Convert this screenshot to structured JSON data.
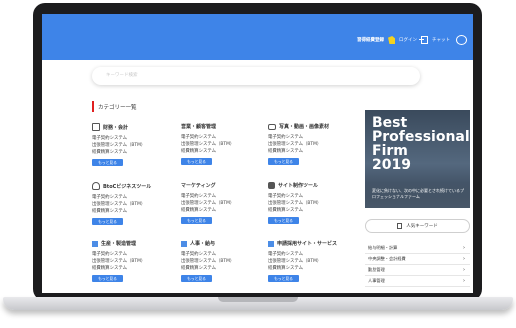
{
  "header": {
    "brand_label": "習得経費登録",
    "login_label": "ログイン",
    "chat_label": "チャット"
  },
  "search": {
    "placeholder": "キーワード検索"
  },
  "category_heading": "カテゴリー一覧",
  "blocks": [
    {
      "icon": "calculator-icon",
      "title": "財務・会計",
      "lines": [
        "電子契約システム",
        "出張管理システム（BTM）",
        "経費精算システム"
      ],
      "more": "もっと見る"
    },
    {
      "icon": "sales-icon",
      "title": "営業・顧客管理",
      "lines": [
        "電子契約システム",
        "出張管理システム（BTM）",
        "経費精算システム"
      ],
      "more": "もっと見る"
    },
    {
      "icon": "camera-icon",
      "title": "写真・動画・画像素材",
      "lines": [
        "電子契約システム",
        "出張管理システム（BTM）",
        "経費精算システム"
      ],
      "more": "もっと見る"
    },
    {
      "icon": "bag-icon",
      "title": "BtoCビジネスツール",
      "lines": [
        "電子契約システム",
        "出張管理システム（BTM）",
        "経費精算システム"
      ],
      "more": "もっと見る"
    },
    {
      "icon": "marketing-icon",
      "title": "マーケティング",
      "lines": [
        "電子契約システム",
        "出張管理システム（BTM）",
        "経費精算システム"
      ],
      "more": "もっと見る"
    },
    {
      "icon": "chip-icon",
      "title": "サイト制作ツール",
      "lines": [
        "電子契約システム",
        "出張管理システム（BTM）",
        "経費精算システム"
      ],
      "more": "もっと見る"
    },
    {
      "icon": "square-icon",
      "title": "生産・製造管理",
      "lines": [
        "電子契約システム",
        "出張管理システム（BTM）",
        "経費精算システム"
      ],
      "more": "もっと見る"
    },
    {
      "icon": "square-icon",
      "title": "人事・給与",
      "lines": [
        "電子契約システム",
        "出張管理システム（BTM）",
        "経費精算システム"
      ],
      "more": "もっと見る"
    },
    {
      "icon": "square-icon",
      "title": "申請採用サイト・サービス",
      "lines": [
        "電子契約システム",
        "出張管理システム（BTM）",
        "経費精算システム"
      ],
      "more": "もっと見る"
    }
  ],
  "ad": {
    "lines": [
      "Best",
      "Professional",
      "Firm",
      "2019"
    ],
    "subtitle": "変化に負けない、次の中に必要とされ続けているプロフェッショナルファーム"
  },
  "keywords": {
    "button_label": "人気キーワード",
    "items": [
      "給与明細・計算",
      "中央調整・会計経費",
      "勤怠管理",
      "人事管理"
    ]
  }
}
